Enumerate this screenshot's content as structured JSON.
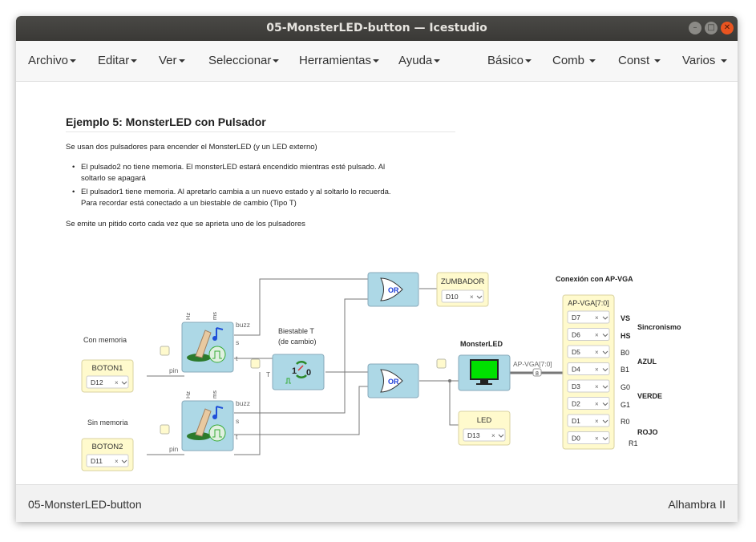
{
  "window": {
    "title": "05-MonsterLED-button — Icestudio"
  },
  "menu": {
    "left": [
      "Archivo",
      "Editar",
      "Ver",
      "Seleccionar",
      "Herramientas",
      "Ayuda"
    ],
    "right": [
      "Básico",
      "Comb",
      "Const",
      "Varios"
    ]
  },
  "info": {
    "heading": "Ejemplo 5: MonsterLED con Pulsador",
    "intro": "Se usan dos pulsadores para encender el MonsterLED (y un LED externo)",
    "bullet1_line1": "El pulsado2 no tiene memoria. El monsterLED estará encendido mientras esté pulsado. Al",
    "bullet1_line2": "soltarlo se apagará",
    "bullet2_line1": "El pulsador1 tiene memoria. Al apretarlo cambia a un nuevo estado y al soltarlo lo recuerda.",
    "bullet2_line2": "Para recordar está conectado a un biestable de cambio (Tipo T)",
    "outro": "Se emite un pitido corto cada vez que se aprieta uno de los pulsadores"
  },
  "diagram": {
    "labels": {
      "con_memoria": "Con memoria",
      "sin_memoria": "Sin memoria",
      "biestable_line1": "Biestable T",
      "biestable_line2": "(de cambio)",
      "monsterled": "MonsterLED",
      "conexion": "Conexión con AP-VGA"
    },
    "inputs": [
      {
        "name": "BOTON1",
        "pin": "D12",
        "port": "pin"
      },
      {
        "name": "BOTON2",
        "pin": "D11",
        "port": "pin"
      }
    ],
    "outputs": [
      {
        "name": "ZUMBADOR",
        "pin": "D10"
      },
      {
        "name": "LED",
        "pin": "D13"
      }
    ],
    "button_block": {
      "hz": "Hz",
      "ms": "ms",
      "buzz": "buzz",
      "s": "s",
      "t": "t"
    },
    "toggle_block": {
      "in": "T",
      "one": "1",
      "zero": "0"
    },
    "gate": {
      "label": "OR"
    },
    "bus_label": "AP-VGA[7:0]",
    "bus_width": "8",
    "vga": {
      "title": "AP-VGA[7:0]",
      "pins": [
        "D7",
        "D6",
        "D5",
        "D4",
        "D3",
        "D2",
        "D1",
        "D0"
      ],
      "signals": [
        "VS",
        "HS",
        "B0",
        "B1",
        "G0",
        "G1",
        "R0",
        "R1"
      ],
      "groups": [
        "Sincronismo",
        "AZUL",
        "VERDE",
        "ROJO"
      ]
    },
    "close_mark": "×"
  },
  "footer": {
    "left": "05-MonsterLED-button",
    "right": "Alhambra II"
  },
  "colors": {
    "block": "#add8e6",
    "io": "#fffacd",
    "accent": "#e95420"
  }
}
